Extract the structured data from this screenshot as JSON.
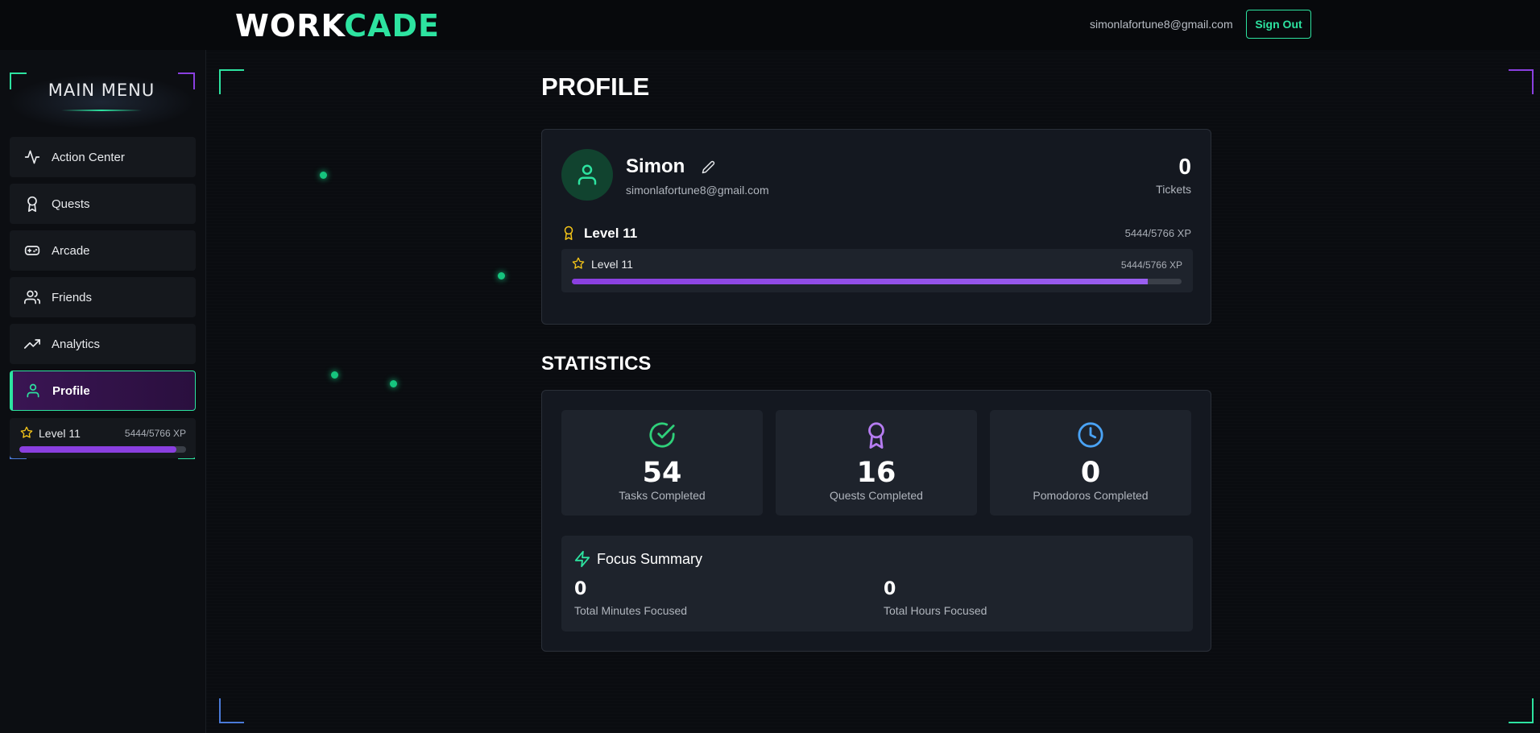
{
  "header": {
    "logo_part1": "WORK",
    "logo_part2": "CADE",
    "user_email": "simonlafortune8@gmail.com",
    "signout_label": "Sign Out"
  },
  "sidebar": {
    "title": "MAIN MENU",
    "items": [
      {
        "label": "Action Center",
        "icon": "activity-icon"
      },
      {
        "label": "Quests",
        "icon": "award-icon"
      },
      {
        "label": "Arcade",
        "icon": "gamepad-icon"
      },
      {
        "label": "Friends",
        "icon": "users-icon"
      },
      {
        "label": "Analytics",
        "icon": "trending-up-icon"
      },
      {
        "label": "Profile",
        "icon": "user-icon",
        "active": true
      }
    ],
    "level": {
      "label": "Level 11",
      "xp": "5444/5766 XP",
      "progress": 0.944
    }
  },
  "profile": {
    "title": "PROFILE",
    "name": "Simon",
    "email": "simonlafortune8@gmail.com",
    "tickets_value": "0",
    "tickets_label": "Tickets",
    "level_label": "Level 11",
    "level_xp": "5444/5766 XP",
    "level_box_label": "Level 11",
    "level_box_xp": "5444/5766 XP",
    "progress": 0.944
  },
  "statistics": {
    "title": "STATISTICS",
    "cards": [
      {
        "value": "54",
        "label": "Tasks Completed",
        "icon": "check-circle-icon",
        "color": "#2fd07a"
      },
      {
        "value": "16",
        "label": "Quests Completed",
        "icon": "award-icon",
        "color": "#b57cf0"
      },
      {
        "value": "0",
        "label": "Pomodoros Completed",
        "icon": "clock-icon",
        "color": "#4aa3f5"
      }
    ],
    "focus": {
      "title": "Focus Summary",
      "minutes_value": "0",
      "minutes_label": "Total Minutes Focused",
      "hours_value": "0",
      "hours_label": "Total Hours Focused"
    }
  },
  "colors": {
    "accent": "#2de3a0",
    "purple": "#8a3fe0",
    "gold": "#f5c518"
  }
}
